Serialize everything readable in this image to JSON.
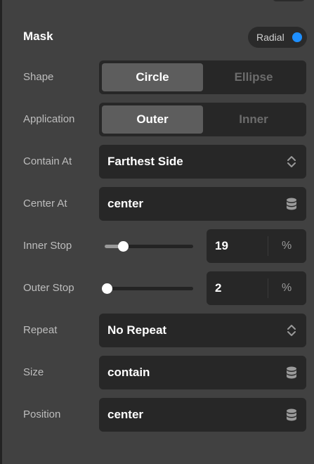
{
  "header": {
    "title": "Mask",
    "mode_label": "Radial",
    "mode_color": "#1e8fff"
  },
  "rows": {
    "shape": {
      "label": "Shape",
      "options": [
        "Circle",
        "Ellipse"
      ],
      "selected": "Circle"
    },
    "application": {
      "label": "Application",
      "options": [
        "Outer",
        "Inner"
      ],
      "selected": "Outer"
    },
    "contain_at": {
      "label": "Contain At",
      "value": "Farthest Side",
      "icon": "updown-chevron-icon"
    },
    "center_at": {
      "label": "Center At",
      "value": "center",
      "icon": "database-icon"
    },
    "inner_stop": {
      "label": "Inner Stop",
      "value": "19",
      "unit": "%"
    },
    "outer_stop": {
      "label": "Outer Stop",
      "value": "2",
      "unit": "%"
    },
    "repeat": {
      "label": "Repeat",
      "value": "No Repeat",
      "icon": "updown-chevron-icon"
    },
    "size": {
      "label": "Size",
      "value": "contain",
      "icon": "database-icon"
    },
    "position": {
      "label": "Position",
      "value": "center",
      "icon": "database-icon"
    }
  },
  "colors": {
    "panel_bg": "#414141",
    "field_bg": "#272727",
    "active_seg": "#5d5d5d",
    "accent": "#1e8fff"
  }
}
